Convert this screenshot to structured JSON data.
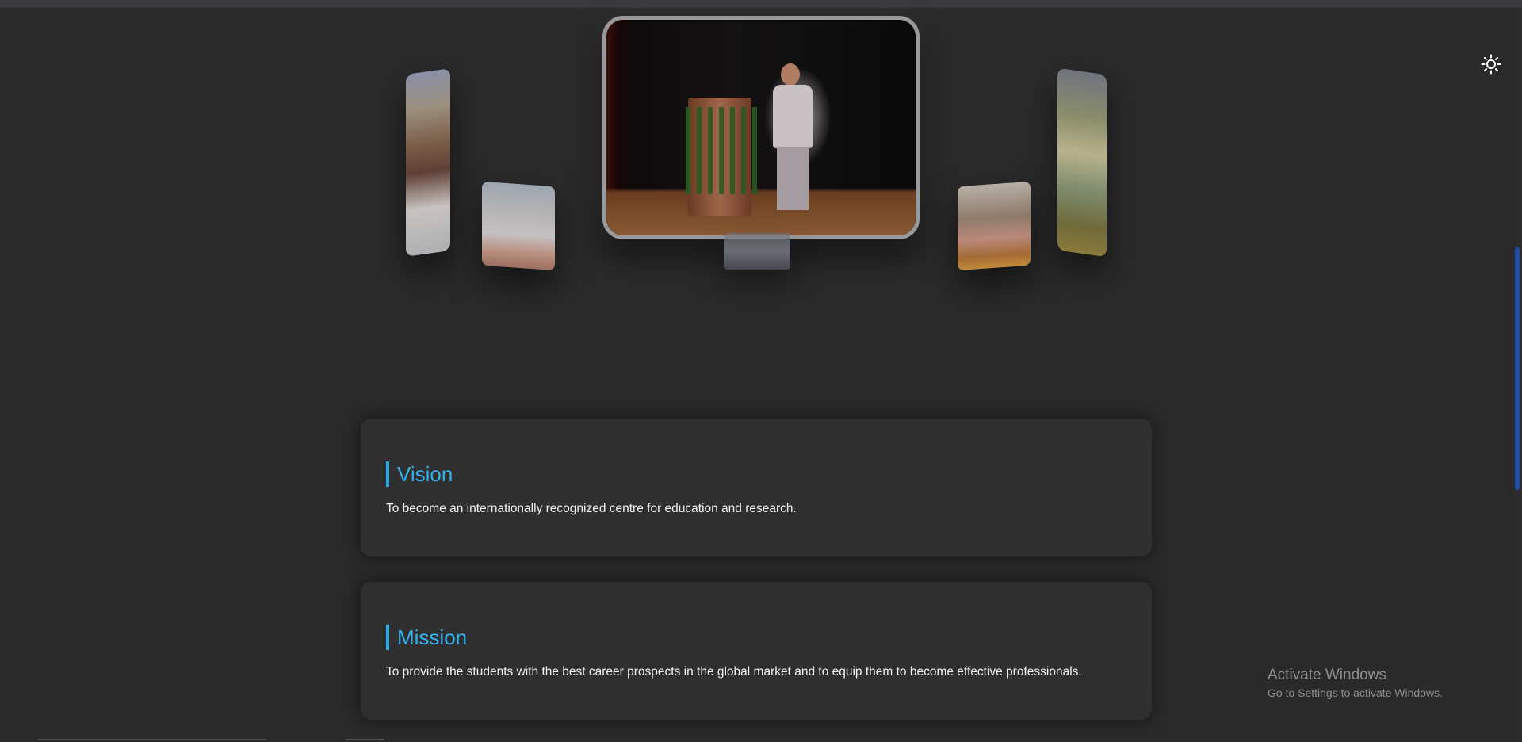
{
  "theme_toggle": {
    "icon": "sun-icon"
  },
  "carousel": {
    "photos": [
      {
        "id": "left-far"
      },
      {
        "id": "left-near"
      },
      {
        "id": "center"
      },
      {
        "id": "bottom"
      },
      {
        "id": "right-near"
      },
      {
        "id": "right-far"
      }
    ]
  },
  "vision": {
    "title": "Vision",
    "text": "To become an internationally recognized centre for education and research."
  },
  "mission": {
    "title": "Mission",
    "text": "To provide the students with the best career prospects in the global market and to equip them to become effective professionals."
  },
  "watermark": {
    "line1": "Activate Windows",
    "line2": "Go to Settings to activate Windows."
  },
  "colors": {
    "background": "#2a2a2b",
    "card": "#2f2f30",
    "accent": "#32b2ee",
    "scrollbar": "#1e4da8"
  }
}
